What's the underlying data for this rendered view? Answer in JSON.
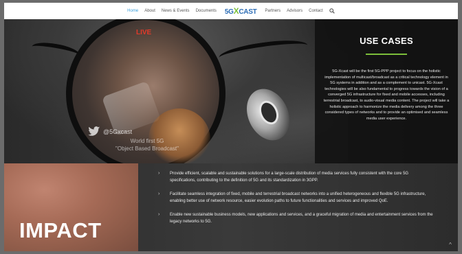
{
  "nav": {
    "items": [
      {
        "label": "Home",
        "active": true
      },
      {
        "label": "About",
        "active": false
      },
      {
        "label": "News & Events",
        "active": false
      },
      {
        "label": "Documents",
        "active": false
      },
      {
        "label": "Partners",
        "active": false
      },
      {
        "label": "Advisors",
        "active": false
      },
      {
        "label": "Contact",
        "active": false
      }
    ],
    "logo": {
      "part1": "5G",
      "part2": "X",
      "part3": "CAST"
    },
    "search_icon": "search-icon"
  },
  "hero": {
    "live_label": "LIVE",
    "twitter_icon": "twitter-icon",
    "twitter_handle": "@5Gxcast",
    "caption_line1": "World first 5G",
    "caption_line2": "\"Object Based Broadcast\""
  },
  "use_cases": {
    "title": "USE CASES",
    "body": "5G-Xcast will be the first 5G-PPP project to focus on the holistic implementation of multicast/broadcast as a critical technology element in 5G systems in addition and as a complement to unicast. 5G-Xcast technologies will be also fundamental to progress towards the vision of a converged 5G infrastructure for fixed and mobile accesses, including terrestrial broadcast, to audio-visual media content. The project will take a holistic approach to harmonize the media delivery among the three considered types of networks and to provide an optimised and seamless media user experience."
  },
  "impact": {
    "title": "IMPACT",
    "bullets": [
      "Provide efficient, scalable and sustainable solutions for a large-scale distribution of media services fully consistent with the core 5G specifications, contributing to the definition of 5G and its standardization in 3GPP.",
      "Facilitate seamless integration of fixed, mobile and terrestrial broadcast networks into a unified heterogeneous and flexible 5G infrastructure, enabling better use of network resource, easier evolution paths to future functionalities and services and improved QoE.",
      "Enable new sustainable business models, new applications and services, and a graceful migration of media and entertainment services from the legacy networks to 5G."
    ],
    "bullet_icon": "chevron-right-icon",
    "scroll_top_icon": "chevron-up-icon"
  },
  "colors": {
    "nav_active": "#3aa0dc",
    "logo_blue": "#2b6cb5",
    "logo_green": "#7cbf3a",
    "live_red": "#e23a2a",
    "accent_rule": "#7cbf3a"
  }
}
